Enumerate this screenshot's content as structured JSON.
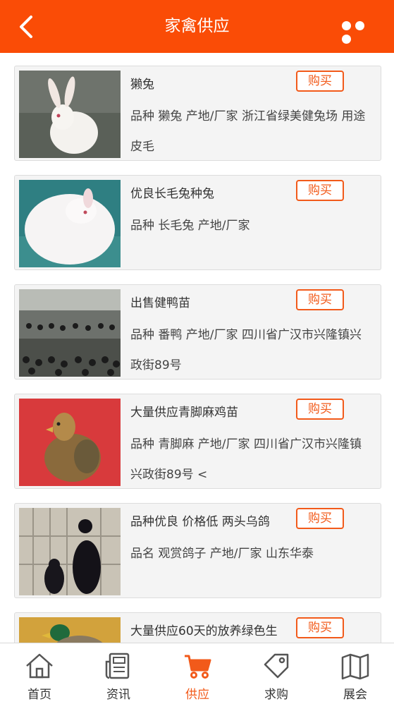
{
  "header": {
    "title": "家禽供应",
    "bg_color": "#fa4c06"
  },
  "buy_label": "购买",
  "products": [
    {
      "name": "獭兔",
      "desc": "品种 獭兔 产地/厂家 浙江省绿美健兔场 用途 皮毛",
      "image": "white-rex-rabbit"
    },
    {
      "name": "优良长毛兔种兔",
      "desc": "品种 长毛兔 产地/厂家",
      "image": "white-angora-rabbit"
    },
    {
      "name": "出售健鸭苗",
      "desc": "品种 番鸭 产地/厂家 四川省广汉市兴隆镇兴政街89号",
      "image": "duck-farm"
    },
    {
      "name": "大量供应青脚麻鸡苗",
      "desc": "品种 青脚麻 产地/厂家 四川省广汉市兴隆镇兴政街89号 <",
      "image": "hen-on-red"
    },
    {
      "name": "品种优良 价格低 两头乌鸽",
      "desc": "品名 观赏鸽子 产地/厂家 山东华泰",
      "image": "black-pigeons"
    },
    {
      "name": "大量供应60天的放养绿色生",
      "desc": "",
      "image": "mallard-duck"
    }
  ],
  "tabbar": [
    {
      "label": "首页",
      "icon": "home-icon",
      "active": false
    },
    {
      "label": "资讯",
      "icon": "news-icon",
      "active": false
    },
    {
      "label": "供应",
      "icon": "cart-icon",
      "active": true
    },
    {
      "label": "求购",
      "icon": "tag-icon",
      "active": false
    },
    {
      "label": "展会",
      "icon": "map-icon",
      "active": false
    }
  ],
  "accent_color": "#f25a1a"
}
